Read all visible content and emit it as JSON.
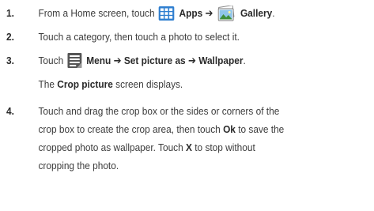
{
  "steps": [
    {
      "number": "1.",
      "before": "From a Home screen, touch",
      "icon1": "apps-grid-icon",
      "bold1": "Apps ➔",
      "icon2": "gallery-photo-icon",
      "bold2": "Gallery",
      "after": "."
    },
    {
      "number": "2.",
      "text": "Touch a category, then touch a photo to select it."
    },
    {
      "number": "3.",
      "before": "Touch",
      "icon": "menu-list-icon",
      "bold": "Menu ➔ Set picture as ➔ Wallpaper",
      "after": ".",
      "sub_before": "The",
      "sub_bold": "Crop picture",
      "sub_after": "screen displays."
    },
    {
      "number": "4.",
      "lines": [
        "Touch and drag the crop box or the sides or corners of the",
        "crop box to create the crop area, then touch",
        "to save the",
        "cropped photo as wallpaper. Touch",
        "to stop without",
        "cropping the photo."
      ],
      "ok_label": "Ok",
      "x_label": "X"
    }
  ],
  "colors": {
    "text": "#3c3c3c",
    "apps_icon_blue": "#2f7fd0",
    "menu_icon_gray": "#555555"
  }
}
